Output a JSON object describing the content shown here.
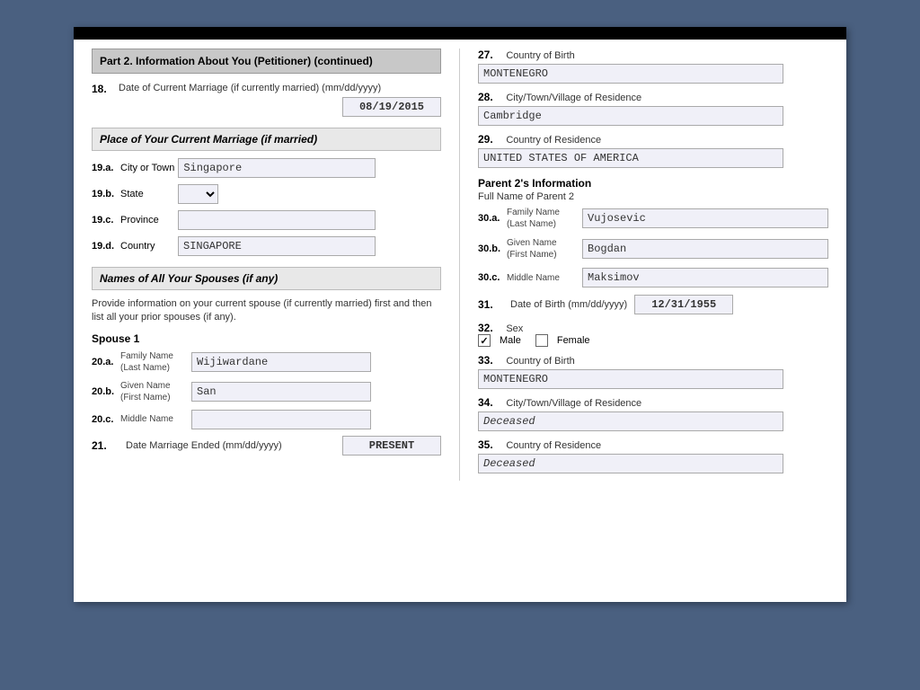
{
  "page": {
    "left": {
      "section_header": "Part 2.  Information About You (Petitioner) (continued)",
      "field_18": {
        "num": "18.",
        "label": "Date of  Current Marriage (if currently married) (mm/dd/yyyy)",
        "value": "08/19/2015"
      },
      "italic_header_marriage": "Place of Your Current Marriage (if married)",
      "field_19a": {
        "num": "19.a.",
        "label": "City or Town",
        "value": "Singapore"
      },
      "field_19b": {
        "num": "19.b.",
        "label": "State",
        "value": ""
      },
      "field_19c": {
        "num": "19.c.",
        "label": "Province",
        "value": ""
      },
      "field_19d": {
        "num": "19.d.",
        "label": "Country",
        "value": "SINGAPORE"
      },
      "italic_header_spouses": "Names of All Your Spouses (if any)",
      "provide_text": "Provide information on your current spouse (if currently married) first and then list all your prior spouses (if any).",
      "spouse_1_label": "Spouse 1",
      "field_20a": {
        "num": "20.a.",
        "sub_label": "Family Name\n(Last Name)",
        "value": "Wijiwardane"
      },
      "field_20b": {
        "num": "20.b.",
        "sub_label": "Given Name\n(First Name)",
        "value": "San"
      },
      "field_20c": {
        "num": "20.c.",
        "sub_label": "Middle Name",
        "value": ""
      },
      "field_21": {
        "num": "21.",
        "label": "Date Marriage Ended (mm/dd/yyyy)",
        "value": "PRESENT"
      }
    },
    "right": {
      "field_27": {
        "num": "27.",
        "label": "Country of Birth",
        "value": "MONTENEGRO"
      },
      "field_28": {
        "num": "28.",
        "label": "City/Town/Village of Residence",
        "value": "Cambridge"
      },
      "field_29": {
        "num": "29.",
        "label": "Country of Residence",
        "value": "UNITED STATES OF AMERICA"
      },
      "parent2_title": "Parent 2's Information",
      "parent2_fullname_label": "Full Name of Parent 2",
      "field_30a": {
        "num": "30.a.",
        "sub_label": "Family Name\n(Last Name)",
        "value": "Vujosevic"
      },
      "field_30b": {
        "num": "30.b.",
        "sub_label": "Given Name\n(First Name)",
        "value": "Bogdan"
      },
      "field_30c": {
        "num": "30.c.",
        "sub_label": "Middle Name",
        "value": "Maksimov"
      },
      "field_31": {
        "num": "31.",
        "label": "Date of Birth (mm/dd/yyyy)",
        "value": "12/31/1955"
      },
      "field_32": {
        "num": "32.",
        "label": "Sex",
        "male_label": "Male",
        "female_label": "Female",
        "male_checked": true,
        "female_checked": false
      },
      "field_33": {
        "num": "33.",
        "label": "Country of Birth",
        "value": "MONTENEGRO"
      },
      "field_34": {
        "num": "34.",
        "label": "City/Town/Village of Residence",
        "value": "Deceased"
      },
      "field_35": {
        "num": "35.",
        "label": "Country of Residence",
        "value": "Deceased"
      }
    }
  }
}
